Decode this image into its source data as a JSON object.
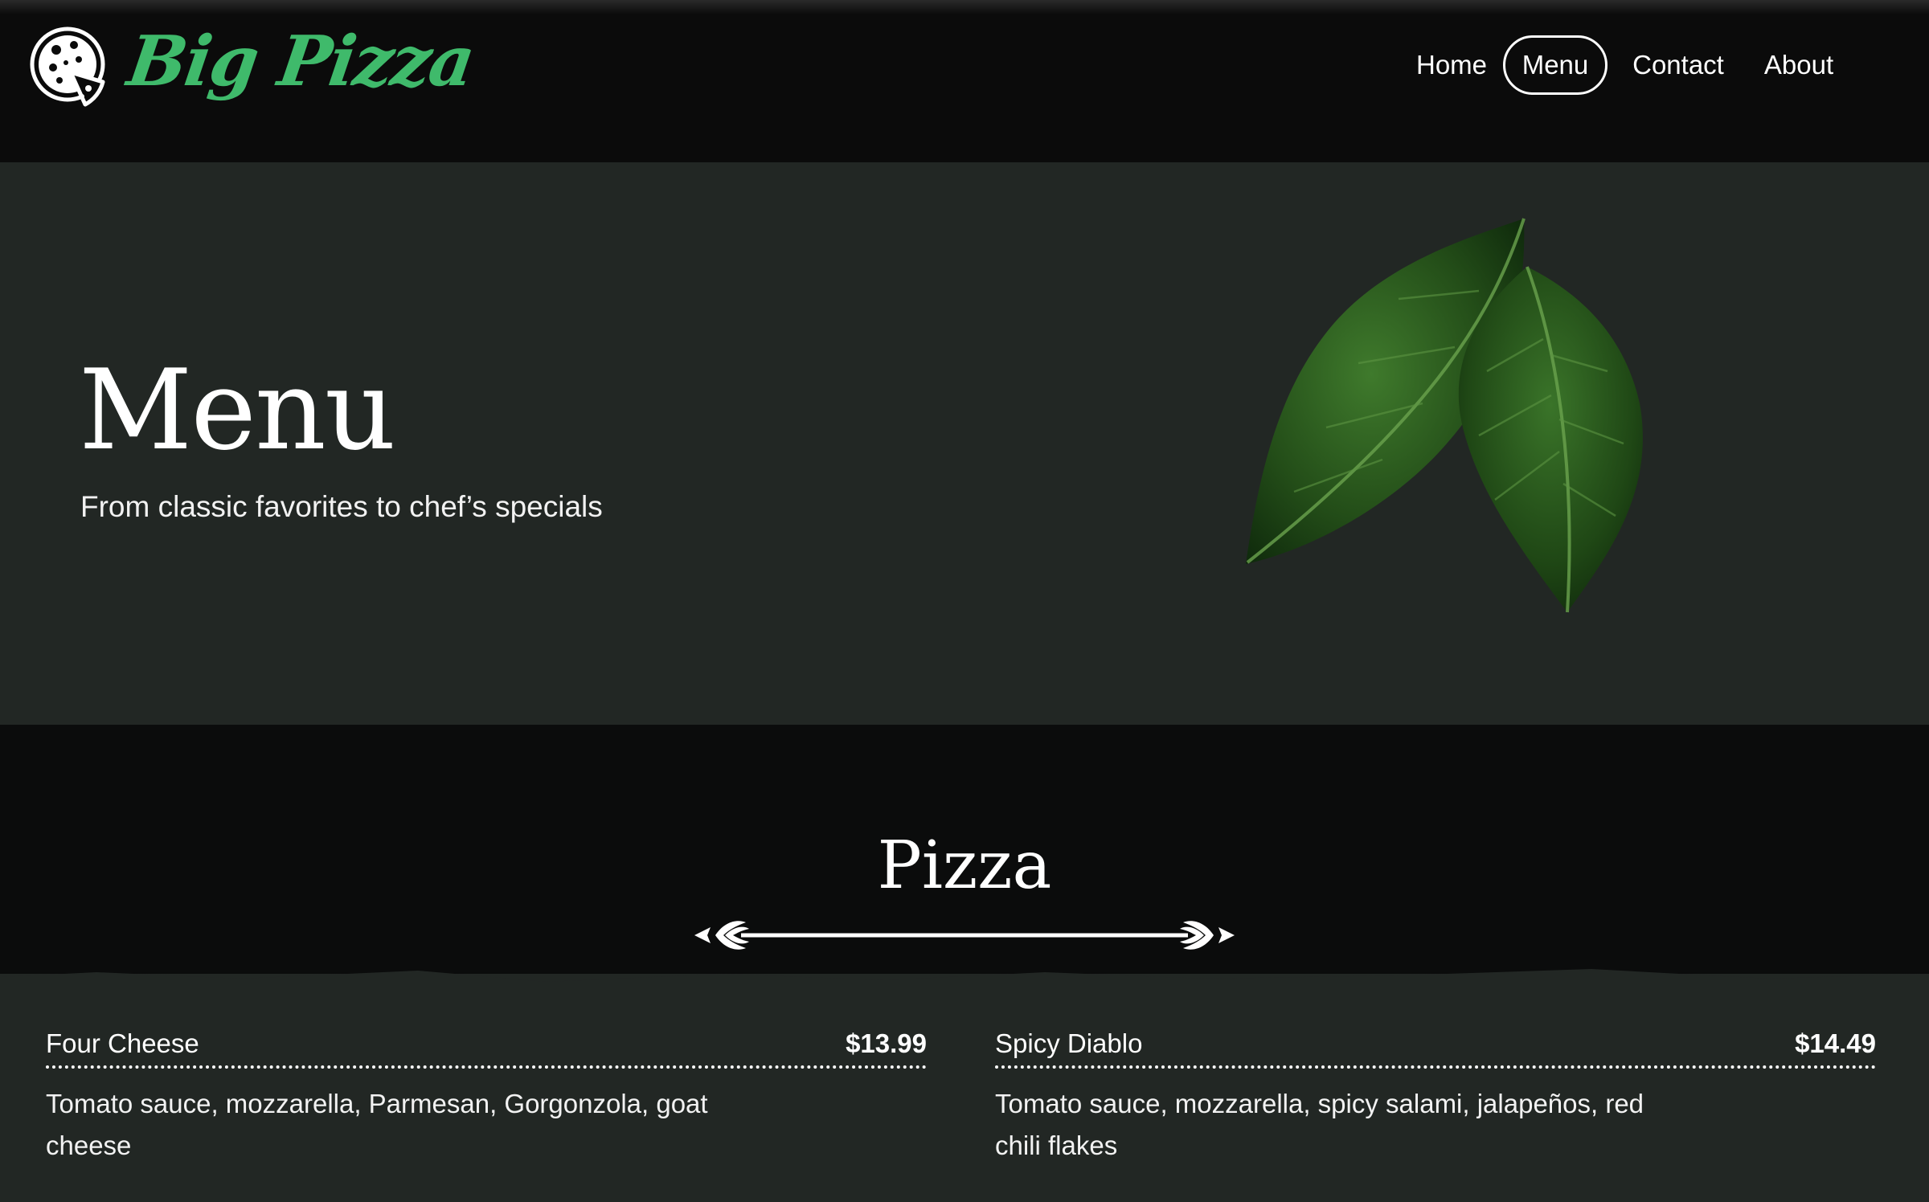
{
  "header": {
    "brand": "Big Pizza",
    "nav": [
      {
        "label": "Home",
        "active": false
      },
      {
        "label": "Menu",
        "active": true
      },
      {
        "label": "Contact",
        "active": false
      },
      {
        "label": "About",
        "active": false
      }
    ]
  },
  "hero": {
    "title": "Menu",
    "subtitle": "From classic favorites to chef’s specials"
  },
  "section": {
    "title": "Pizza",
    "items": [
      {
        "name": "Four Cheese",
        "price": "$13.99",
        "description": "Tomato sauce, mozzarella, Parmesan, Gorgonzola, goat cheese"
      },
      {
        "name": "Spicy Diablo",
        "price": "$14.49",
        "description": "Tomato sauce, mozzarella, spicy salami, jalapeños, red chili flakes"
      }
    ]
  },
  "colors": {
    "accent_green": "#3fba6b",
    "header_bg": "#0b0b0b",
    "panel_bg": "#222724"
  },
  "icons": {
    "logo": "pizza-logo-icon",
    "decor": "basil-leaves-image",
    "divider": "ornamental-divider-icon"
  }
}
